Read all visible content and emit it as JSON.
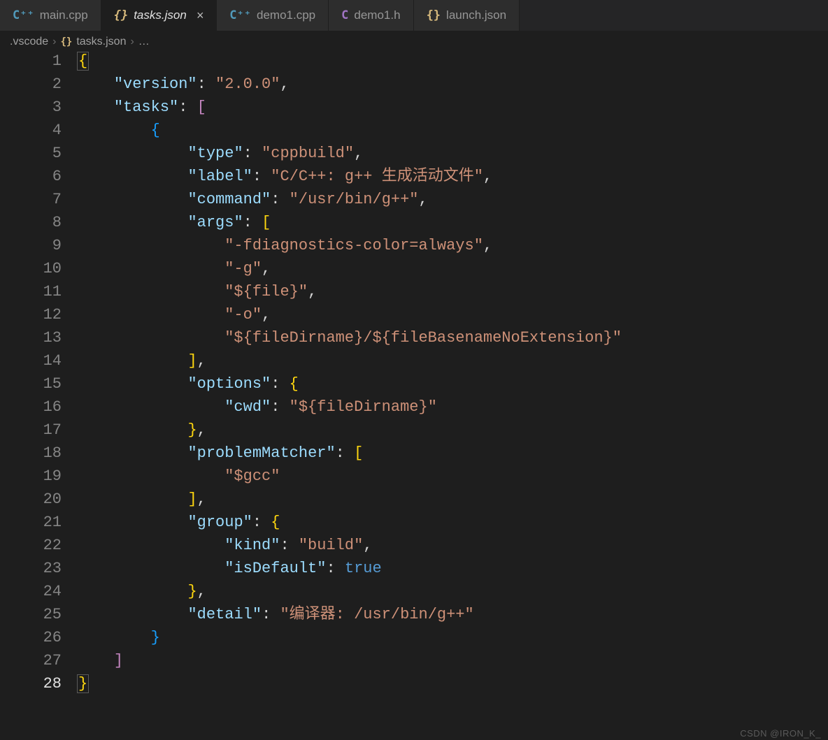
{
  "tabs": [
    {
      "icon": "cpp",
      "icon_char": "C⁺⁺",
      "label": "main.cpp",
      "active": false
    },
    {
      "icon": "braces",
      "icon_char": "{}",
      "label": "tasks.json",
      "active": true,
      "close": "×"
    },
    {
      "icon": "cpp",
      "icon_char": "C⁺⁺",
      "label": "demo1.cpp",
      "active": false
    },
    {
      "icon": "h",
      "icon_char": "C",
      "label": "demo1.h",
      "active": false
    },
    {
      "icon": "braces",
      "icon_char": "{}",
      "label": "launch.json",
      "active": false
    }
  ],
  "breadcrumb": {
    "seg1": ".vscode",
    "seg2_icon": "{}",
    "seg2": "tasks.json",
    "seg3": "…",
    "sep": "›"
  },
  "line_numbers": [
    "1",
    "2",
    "3",
    "4",
    "5",
    "6",
    "7",
    "8",
    "9",
    "10",
    "11",
    "12",
    "13",
    "14",
    "15",
    "16",
    "17",
    "18",
    "19",
    "20",
    "21",
    "22",
    "23",
    "24",
    "25",
    "26",
    "27",
    "28"
  ],
  "current_line": 28,
  "code": {
    "l1": "{",
    "l2_k": "\"version\"",
    "l2_v": "\"2.0.0\"",
    "l3_k": "\"tasks\"",
    "l4": "{",
    "l5_k": "\"type\"",
    "l5_v": "\"cppbuild\"",
    "l6_k": "\"label\"",
    "l6_v": "\"C/C++: g++ 生成活动文件\"",
    "l7_k": "\"command\"",
    "l7_v": "\"/usr/bin/g++\"",
    "l8_k": "\"args\"",
    "l9_v": "\"-fdiagnostics-color=always\"",
    "l10_v": "\"-g\"",
    "l11_v": "\"${file}\"",
    "l12_v": "\"-o\"",
    "l13_v": "\"${fileDirname}/${fileBasenameNoExtension}\"",
    "l15_k": "\"options\"",
    "l16_k": "\"cwd\"",
    "l16_v": "\"${fileDirname}\"",
    "l18_k": "\"problemMatcher\"",
    "l19_v": "\"$gcc\"",
    "l21_k": "\"group\"",
    "l22_k": "\"kind\"",
    "l22_v": "\"build\"",
    "l23_k": "\"isDefault\"",
    "l23_v": "true",
    "l25_k": "\"detail\"",
    "l25_v": "\"编译器: /usr/bin/g++\"",
    "l28": "}"
  },
  "watermark": "CSDN @IRON_K_"
}
